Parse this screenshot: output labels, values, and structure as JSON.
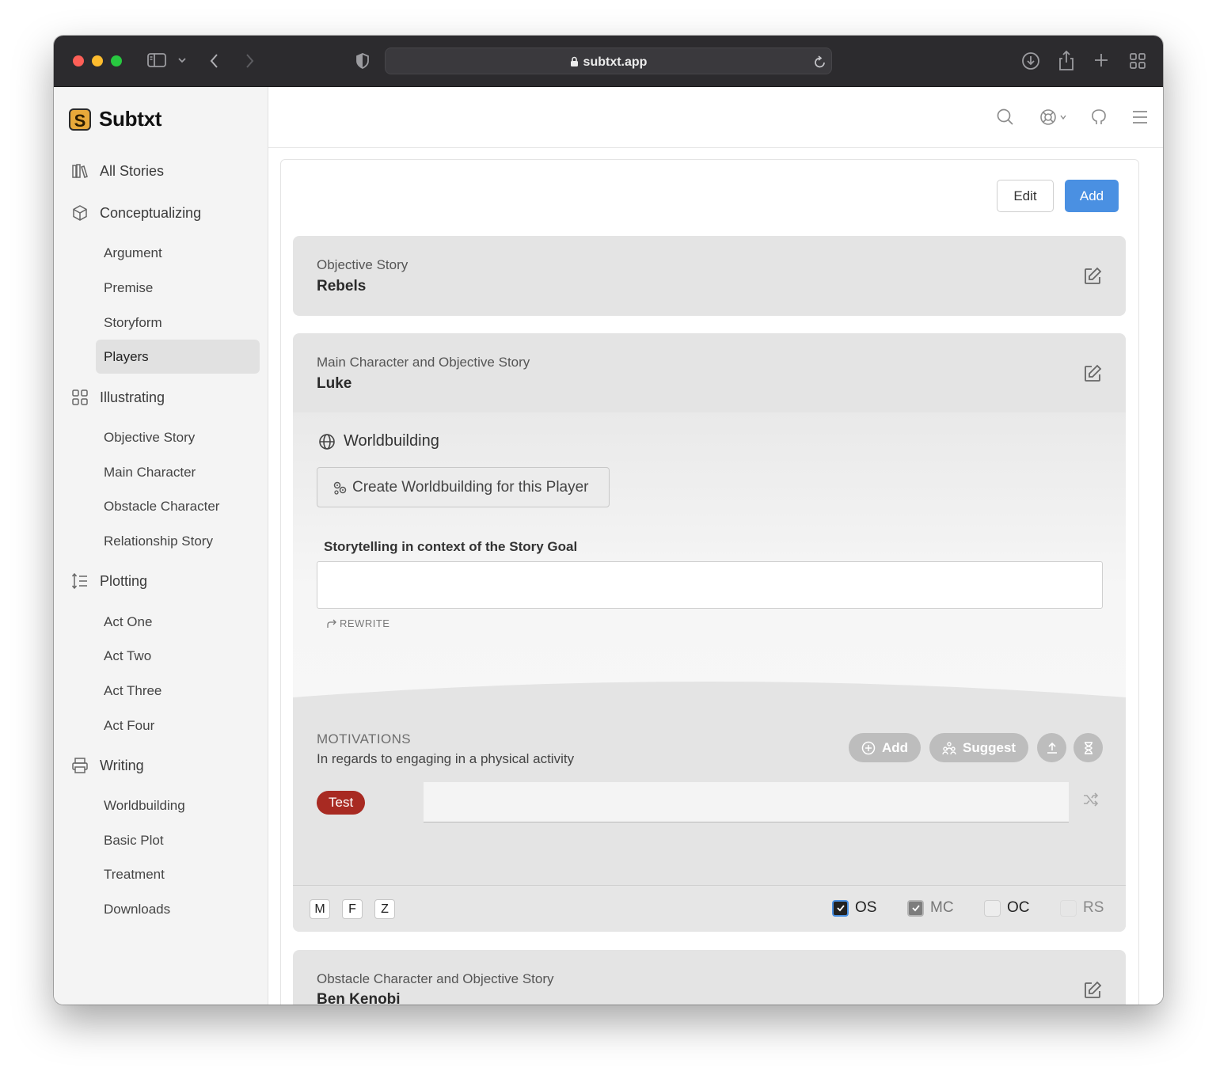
{
  "browser": {
    "url": "subtxt.app"
  },
  "brand": {
    "name": "Subtxt",
    "logo_letter": "S",
    "accent": "#e8a93a"
  },
  "sidebar": {
    "sections": [
      {
        "label": "All Stories",
        "icon": "books-icon"
      },
      {
        "label": "Conceptualizing",
        "icon": "cube-icon",
        "items": [
          "Argument",
          "Premise",
          "Storyform",
          "Players"
        ]
      },
      {
        "label": "Illustrating",
        "icon": "grid-icon",
        "items": [
          "Objective Story",
          "Main Character",
          "Obstacle Character",
          "Relationship Story"
        ]
      },
      {
        "label": "Plotting",
        "icon": "list-sort-icon",
        "items": [
          "Act One",
          "Act Two",
          "Act Three",
          "Act Four"
        ]
      },
      {
        "label": "Writing",
        "icon": "printer-icon",
        "items": [
          "Worldbuilding",
          "Basic Plot",
          "Treatment",
          "Downloads"
        ]
      }
    ],
    "active_item": "Players"
  },
  "toolbar": {
    "edit_label": "Edit",
    "add_label": "Add",
    "accent": "#4a90e2"
  },
  "players": [
    {
      "label": "Objective Story",
      "name": "Rebels"
    },
    {
      "label": "Main Character and Objective Story",
      "name": "Luke"
    },
    {
      "label": "Obstacle Character and Objective Story",
      "name": "Ben Kenobi"
    }
  ],
  "worldbuilding": {
    "title": "Worldbuilding",
    "create_button": "Create Worldbuilding for this Player",
    "storytelling_label": "Storytelling in context of the Story Goal",
    "storytelling_value": "",
    "rewrite_label": "REWRITE"
  },
  "motivations": {
    "title": "MOTIVATIONS",
    "subtitle": "In regards to engaging in a physical activity",
    "add_label": "Add",
    "suggest_label": "Suggest",
    "badge": "Test",
    "badge_color": "#a82a22",
    "value": ""
  },
  "footer": {
    "keys": [
      "M",
      "F",
      "Z"
    ],
    "checks": [
      {
        "label": "OS",
        "checked": true
      },
      {
        "label": "MC",
        "checked": true
      },
      {
        "label": "OC",
        "checked": false
      },
      {
        "label": "RS",
        "checked": false
      }
    ]
  }
}
